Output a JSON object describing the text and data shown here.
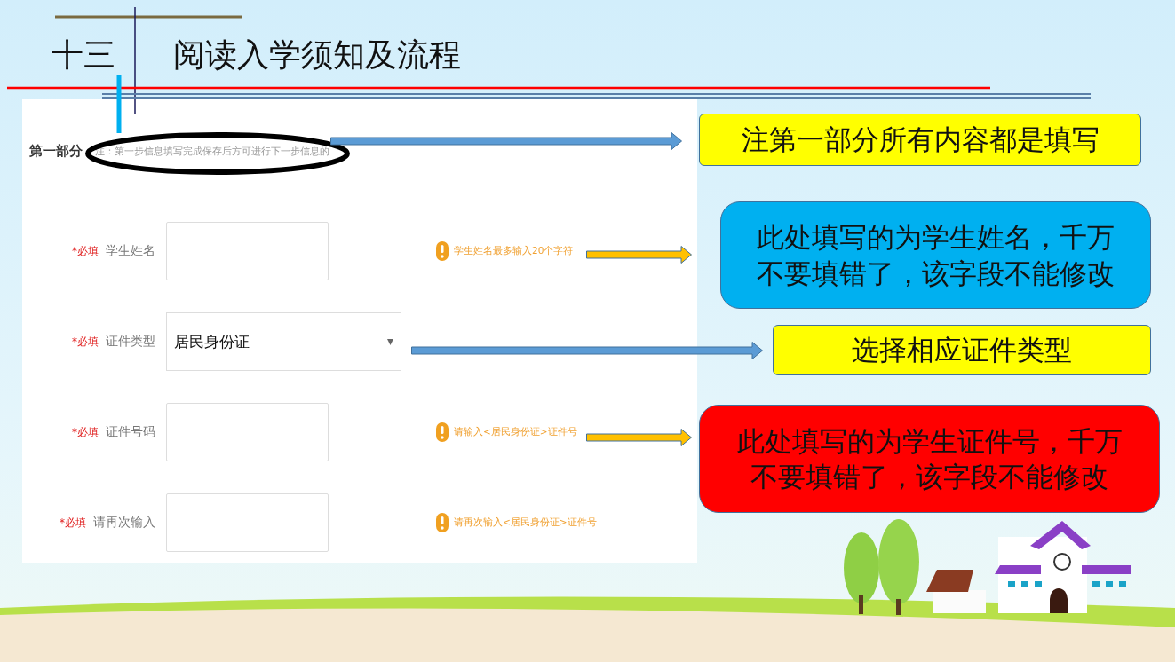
{
  "title": {
    "number": "十三",
    "text": "阅读入学须知及流程"
  },
  "form": {
    "section_title": "第一部分",
    "note": "注：第一步信息填写完成保存后方可进行下一步信息的",
    "fields": [
      {
        "kind": "text",
        "required": "*必填",
        "label": "学生姓名",
        "hint": "学生姓名最多输入20个字符"
      },
      {
        "kind": "select",
        "required": "*必填",
        "label": "证件类型",
        "value": "居民身份证"
      },
      {
        "kind": "text",
        "required": "*必填",
        "label": "证件号码",
        "hint": "请输入<居民身份证>证件号"
      },
      {
        "kind": "text",
        "required": "*必填",
        "label": "请再次输入",
        "hint": "请再次输入<居民身份证>证件号"
      }
    ]
  },
  "callouts": [
    {
      "text": "注第一部分所有内容都是填写",
      "color": "#ffff00"
    },
    {
      "text": "此处填写的为学生姓名，千万不要填错了，该字段不能修改",
      "color": "#00b0f0"
    },
    {
      "text": "选择相应证件类型",
      "color": "#ffff00"
    },
    {
      "text": "此处填写的为学生证件号，千万不要填错了，该字段不能修改",
      "color": "#ff0000"
    }
  ]
}
